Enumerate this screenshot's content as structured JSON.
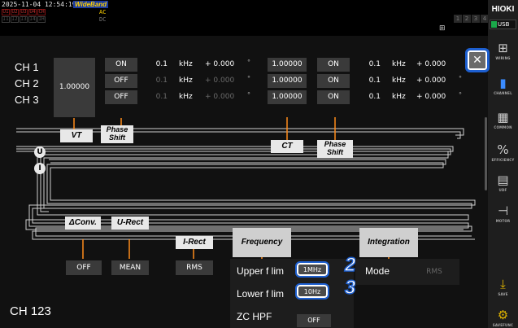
{
  "status": {
    "timestamp": "2025-11-04 12:54:19",
    "mode_badge": "WideBand",
    "lamps_row1": [
      "U1",
      "U2",
      "U3",
      "U4",
      "CH"
    ],
    "lamps_row2": [
      "I1",
      "I2",
      "I3",
      "I4",
      "IH"
    ],
    "ac_row1": "AC",
    "ac_row2": "DC",
    "net_icon": "network-icon",
    "channels": [
      "1",
      "2",
      "3",
      "4"
    ]
  },
  "side": {
    "brand": "HIOKI",
    "usb": "USB",
    "items": [
      {
        "label": "WIRING",
        "icon": "wiring-icon"
      },
      {
        "label": "CHANNEL",
        "icon": "channel-icon",
        "active": true
      },
      {
        "label": "COMMON",
        "icon": "common-icon"
      },
      {
        "label": "EFFICIENCY",
        "icon": "efficiency-icon"
      },
      {
        "label": "UDF",
        "icon": "udf-icon"
      },
      {
        "label": "MOTOR",
        "icon": "motor-icon"
      },
      {
        "label": "SAVE",
        "icon": "save-icon"
      },
      {
        "label": "SAVEFUNC",
        "icon": "savefunc-icon"
      }
    ]
  },
  "rows": {
    "labels": [
      "CH 1",
      "CH 2",
      "CH 3"
    ]
  },
  "vt": {
    "ratio": "1.00000",
    "phase": [
      {
        "state": "ON",
        "freq": "0.1",
        "unit": "kHz",
        "deg": "+ 0.000",
        "dim": false
      },
      {
        "state": "OFF",
        "freq": "0.1",
        "unit": "kHz",
        "deg": "+ 0.000",
        "dim": true
      },
      {
        "state": "OFF",
        "freq": "0.1",
        "unit": "kHz",
        "deg": "+ 0.000",
        "dim": true
      }
    ],
    "deg_symbol": "°"
  },
  "ct": {
    "ratios": [
      "1.00000",
      "1.00000",
      "1.00000"
    ],
    "phase": [
      {
        "state": "ON",
        "freq": "0.1",
        "unit": "kHz",
        "deg": "+ 0.000"
      },
      {
        "state": "ON",
        "freq": "0.1",
        "unit": "kHz",
        "deg": "+ 0.000"
      },
      {
        "state": "ON",
        "freq": "0.1",
        "unit": "kHz",
        "deg": "+ 0.000"
      }
    ]
  },
  "diagram": {
    "u": "U",
    "i": "I",
    "vt": "VT",
    "phase_shift_1": "Phase\nShift",
    "ct": "CT",
    "phase_shift_2": "Phase\nShift",
    "dconv": "ΔConv.",
    "urect": "U-Rect",
    "irect": "I-Rect",
    "frequency": "Frequency",
    "integration": "Integration"
  },
  "bottom": {
    "dconv_value": "OFF",
    "urect_value": "MEAN",
    "irect_value": "RMS"
  },
  "freq": {
    "upper_label": "Upper f lim",
    "upper_value": "1MHz",
    "lower_label": "Lower f lim",
    "lower_value": "10Hz",
    "zc_label": "ZC HPF",
    "zc_value": "OFF",
    "callout_upper": "2",
    "callout_lower": "3"
  },
  "integration": {
    "mode_label": "Mode",
    "mode_value": "RMS"
  },
  "footer": {
    "channel_group": "CH 123"
  },
  "close_label": "✕",
  "colors": {
    "accent": "#1d5fd0",
    "orange_line": "#ff8c1a",
    "panel": "#111111",
    "box": "#3a3a3a"
  }
}
